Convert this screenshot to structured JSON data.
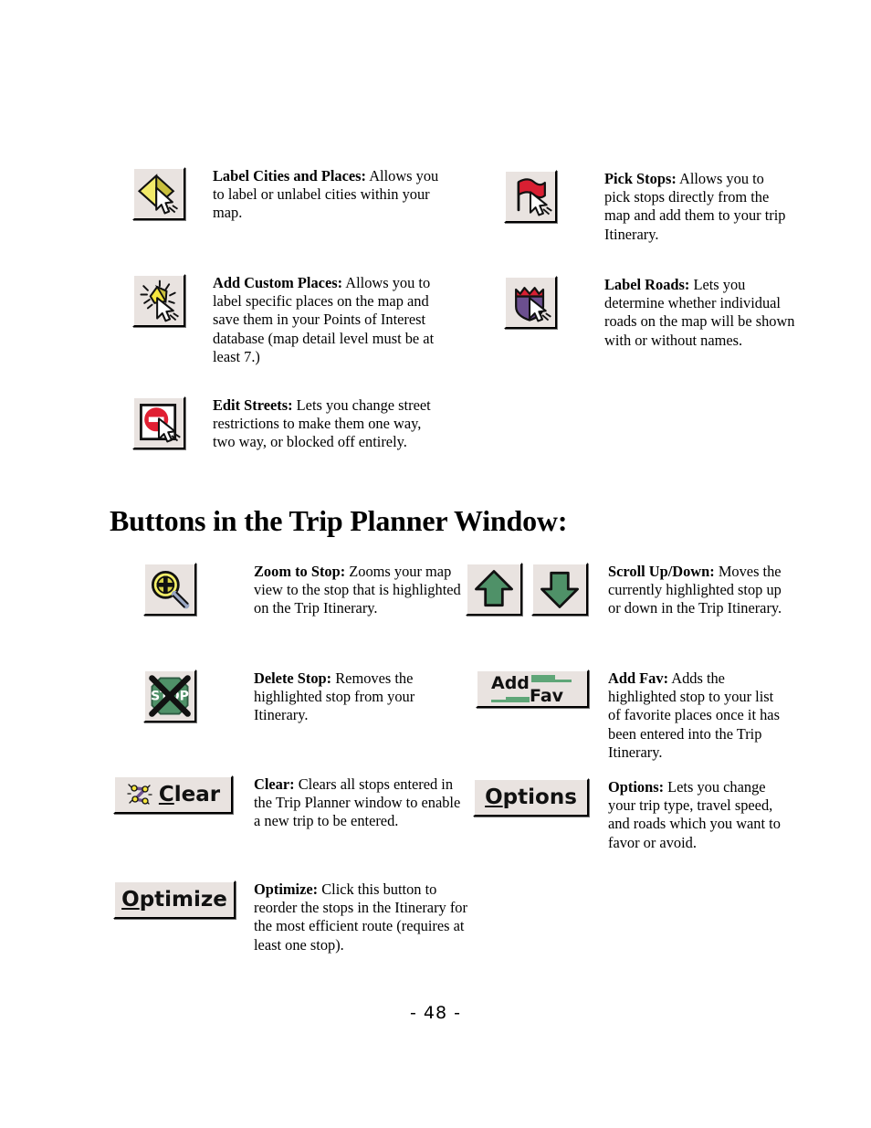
{
  "page": {
    "number_label": "- 48 -",
    "section_heading": "Buttons in the Trip Planner Window:"
  },
  "colors": {
    "button_face": "#e9e3e0",
    "highlight": "#ffffff",
    "shadow": "#000000",
    "icon_yellow": "#e3d94a",
    "icon_gold": "#f5e53f",
    "icon_red": "#d81f32",
    "icon_purple": "#6b4f8f",
    "icon_green": "#4f9168",
    "icon_white": "#ffffff",
    "text": "#000000"
  },
  "map_buttons": [
    {
      "id": "label-cities-and-places",
      "icon": "diamond-cursor-icon",
      "term": "Label Cities and Places:",
      "description": "Allows you to label or unlabel cities within your map."
    },
    {
      "id": "add-custom-places",
      "icon": "sparkle-star-cursor-icon",
      "term": "Add Custom Places:",
      "description": "Allows you to label specific places on the map and save them in your Points of Interest database (map detail level must be at least 7.)"
    },
    {
      "id": "edit-streets",
      "icon": "do-not-enter-cursor-icon",
      "term": "Edit Streets:",
      "description": "Lets you change street restrictions to make them one way, two way, or blocked off entirely."
    },
    {
      "id": "pick-stops",
      "icon": "red-flag-cursor-icon",
      "term": "Pick Stops:",
      "description": "Allows you to pick stops directly from the map and add them to your trip Itinerary."
    },
    {
      "id": "label-roads",
      "icon": "road-shield-cursor-icon",
      "term": "Label Roads:",
      "description": "Lets you determine whether individual roads on the map will be shown with or without names."
    }
  ],
  "trip_planner_buttons": [
    {
      "id": "zoom-to-stop",
      "icon": "magnifier-plus-icon",
      "term": "Zoom to Stop:",
      "description": "Zooms your map view to the stop that is highlighted on the Trip Itinerary."
    },
    {
      "id": "delete-stop",
      "icon": "stop-sign-crossed-out-icon",
      "term": "Delete Stop:",
      "description": "Removes the highlighted stop from your Itinerary."
    },
    {
      "id": "clear",
      "icon": "route-zigzag-icon",
      "button_label": "Clear",
      "button_label_underlined_char": "C",
      "term": "Clear:",
      "description": "Clears all stops entered in the Trip Planner window to enable a new trip to be entered."
    },
    {
      "id": "optimize",
      "icon": "none",
      "button_label": "Optimize",
      "button_label_underlined_char": "O",
      "term": "Optimize:",
      "description": "Click this button to reorder the stops in the Itinerary for the most efficient route (requires at least one stop)."
    },
    {
      "id": "scroll-up-down",
      "icon": "green-arrow-up-icon,green-arrow-down-icon",
      "term": "Scroll Up/Down:",
      "description": "Moves the currently highlighted stop up or down in the Trip Itinerary."
    },
    {
      "id": "add-fav",
      "icon": "add-fav-icon",
      "button_label_line1": "Add",
      "button_label_line2": "Fav",
      "term": "Add Fav:",
      "description": "Adds the highlighted stop to your list of favorite places once it has been entered into the Trip Itinerary."
    },
    {
      "id": "options",
      "icon": "none",
      "button_label": "Options",
      "button_label_underlined_char": "O",
      "term": "Options:",
      "description": "Lets you change your trip type, travel speed, and roads which you want to favor or avoid."
    }
  ]
}
